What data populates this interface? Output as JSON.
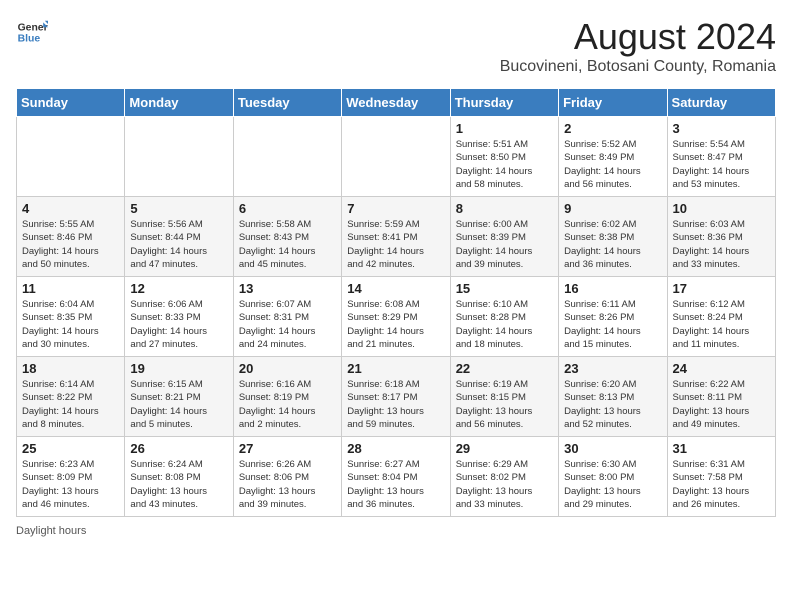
{
  "logo": {
    "text_general": "General",
    "text_blue": "Blue"
  },
  "title": "August 2024",
  "subtitle": "Bucovineni, Botosani County, Romania",
  "days_of_week": [
    "Sunday",
    "Monday",
    "Tuesday",
    "Wednesday",
    "Thursday",
    "Friday",
    "Saturday"
  ],
  "footer": "Daylight hours",
  "weeks": [
    [
      {
        "day": "",
        "info": ""
      },
      {
        "day": "",
        "info": ""
      },
      {
        "day": "",
        "info": ""
      },
      {
        "day": "",
        "info": ""
      },
      {
        "day": "1",
        "info": "Sunrise: 5:51 AM\nSunset: 8:50 PM\nDaylight: 14 hours\nand 58 minutes."
      },
      {
        "day": "2",
        "info": "Sunrise: 5:52 AM\nSunset: 8:49 PM\nDaylight: 14 hours\nand 56 minutes."
      },
      {
        "day": "3",
        "info": "Sunrise: 5:54 AM\nSunset: 8:47 PM\nDaylight: 14 hours\nand 53 minutes."
      }
    ],
    [
      {
        "day": "4",
        "info": "Sunrise: 5:55 AM\nSunset: 8:46 PM\nDaylight: 14 hours\nand 50 minutes."
      },
      {
        "day": "5",
        "info": "Sunrise: 5:56 AM\nSunset: 8:44 PM\nDaylight: 14 hours\nand 47 minutes."
      },
      {
        "day": "6",
        "info": "Sunrise: 5:58 AM\nSunset: 8:43 PM\nDaylight: 14 hours\nand 45 minutes."
      },
      {
        "day": "7",
        "info": "Sunrise: 5:59 AM\nSunset: 8:41 PM\nDaylight: 14 hours\nand 42 minutes."
      },
      {
        "day": "8",
        "info": "Sunrise: 6:00 AM\nSunset: 8:39 PM\nDaylight: 14 hours\nand 39 minutes."
      },
      {
        "day": "9",
        "info": "Sunrise: 6:02 AM\nSunset: 8:38 PM\nDaylight: 14 hours\nand 36 minutes."
      },
      {
        "day": "10",
        "info": "Sunrise: 6:03 AM\nSunset: 8:36 PM\nDaylight: 14 hours\nand 33 minutes."
      }
    ],
    [
      {
        "day": "11",
        "info": "Sunrise: 6:04 AM\nSunset: 8:35 PM\nDaylight: 14 hours\nand 30 minutes."
      },
      {
        "day": "12",
        "info": "Sunrise: 6:06 AM\nSunset: 8:33 PM\nDaylight: 14 hours\nand 27 minutes."
      },
      {
        "day": "13",
        "info": "Sunrise: 6:07 AM\nSunset: 8:31 PM\nDaylight: 14 hours\nand 24 minutes."
      },
      {
        "day": "14",
        "info": "Sunrise: 6:08 AM\nSunset: 8:29 PM\nDaylight: 14 hours\nand 21 minutes."
      },
      {
        "day": "15",
        "info": "Sunrise: 6:10 AM\nSunset: 8:28 PM\nDaylight: 14 hours\nand 18 minutes."
      },
      {
        "day": "16",
        "info": "Sunrise: 6:11 AM\nSunset: 8:26 PM\nDaylight: 14 hours\nand 15 minutes."
      },
      {
        "day": "17",
        "info": "Sunrise: 6:12 AM\nSunset: 8:24 PM\nDaylight: 14 hours\nand 11 minutes."
      }
    ],
    [
      {
        "day": "18",
        "info": "Sunrise: 6:14 AM\nSunset: 8:22 PM\nDaylight: 14 hours\nand 8 minutes."
      },
      {
        "day": "19",
        "info": "Sunrise: 6:15 AM\nSunset: 8:21 PM\nDaylight: 14 hours\nand 5 minutes."
      },
      {
        "day": "20",
        "info": "Sunrise: 6:16 AM\nSunset: 8:19 PM\nDaylight: 14 hours\nand 2 minutes."
      },
      {
        "day": "21",
        "info": "Sunrise: 6:18 AM\nSunset: 8:17 PM\nDaylight: 13 hours\nand 59 minutes."
      },
      {
        "day": "22",
        "info": "Sunrise: 6:19 AM\nSunset: 8:15 PM\nDaylight: 13 hours\nand 56 minutes."
      },
      {
        "day": "23",
        "info": "Sunrise: 6:20 AM\nSunset: 8:13 PM\nDaylight: 13 hours\nand 52 minutes."
      },
      {
        "day": "24",
        "info": "Sunrise: 6:22 AM\nSunset: 8:11 PM\nDaylight: 13 hours\nand 49 minutes."
      }
    ],
    [
      {
        "day": "25",
        "info": "Sunrise: 6:23 AM\nSunset: 8:09 PM\nDaylight: 13 hours\nand 46 minutes."
      },
      {
        "day": "26",
        "info": "Sunrise: 6:24 AM\nSunset: 8:08 PM\nDaylight: 13 hours\nand 43 minutes."
      },
      {
        "day": "27",
        "info": "Sunrise: 6:26 AM\nSunset: 8:06 PM\nDaylight: 13 hours\nand 39 minutes."
      },
      {
        "day": "28",
        "info": "Sunrise: 6:27 AM\nSunset: 8:04 PM\nDaylight: 13 hours\nand 36 minutes."
      },
      {
        "day": "29",
        "info": "Sunrise: 6:29 AM\nSunset: 8:02 PM\nDaylight: 13 hours\nand 33 minutes."
      },
      {
        "day": "30",
        "info": "Sunrise: 6:30 AM\nSunset: 8:00 PM\nDaylight: 13 hours\nand 29 minutes."
      },
      {
        "day": "31",
        "info": "Sunrise: 6:31 AM\nSunset: 7:58 PM\nDaylight: 13 hours\nand 26 minutes."
      }
    ]
  ]
}
